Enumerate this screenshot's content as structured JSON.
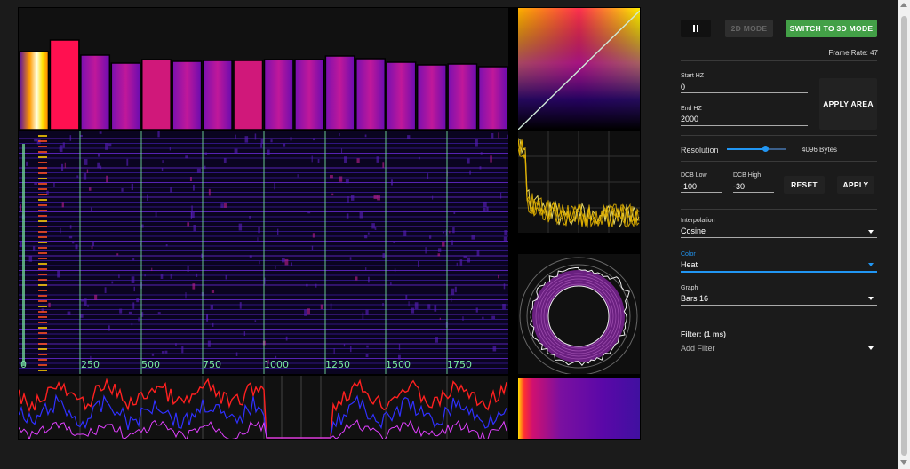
{
  "viz": {
    "axis_ticks": [
      "0",
      "250",
      "500",
      "750",
      "1000",
      "1250",
      "1500",
      "1750"
    ]
  },
  "controls": {
    "pause_icon": "pause-icon",
    "mode_2d_label": "2D MODE",
    "mode_3d_label": "SWITCH TO 3D MODE",
    "frame_rate": "Frame Rate: 47",
    "start_hz_label": "Start HZ",
    "start_hz_value": "0",
    "end_hz_label": "End HZ",
    "end_hz_value": "2000",
    "apply_area_label": "APPLY AREA",
    "resolution_label": "Resolution",
    "resolution_value": "4096 Bytes",
    "resolution_level": 0.66,
    "dcb_low_label": "DCB Low",
    "dcb_low_value": "-100",
    "dcb_high_label": "DCB High",
    "dcb_high_value": "-30",
    "reset_label": "RESET",
    "apply_label": "APPLY",
    "interpolation_label": "Interpolation",
    "interpolation_value": "Cosine",
    "color_label": "Color",
    "color_value": "Heat",
    "graph_label": "Graph",
    "graph_value": "Bars 16",
    "filter_title": "Filter: (1 ms)",
    "add_filter_placeholder": "Add Filter"
  },
  "colors": {
    "accent_green": "#43a047",
    "accent_blue": "#2196f3",
    "axis_green": "#78e8a0"
  }
}
